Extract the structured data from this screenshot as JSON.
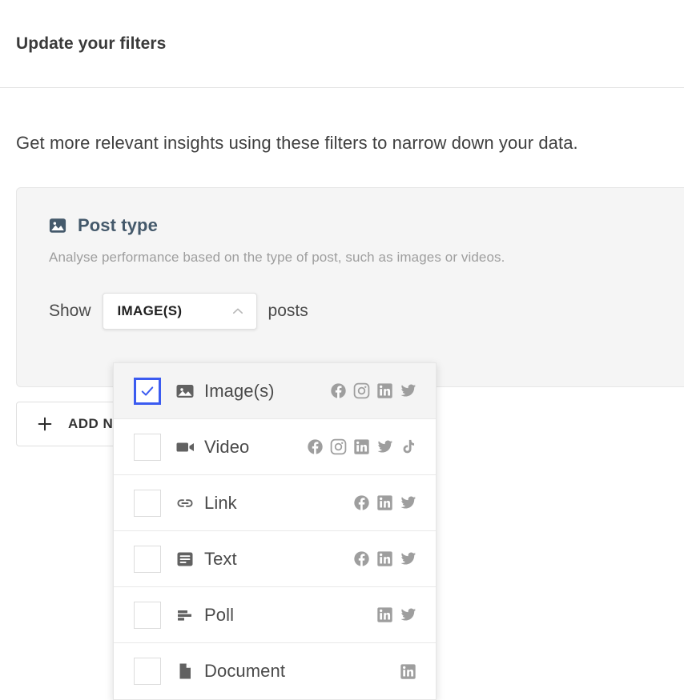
{
  "header": {
    "title": "Update your filters"
  },
  "body": {
    "intro": "Get more relevant insights using these filters to narrow down your data."
  },
  "filter_card": {
    "icon": "image-icon",
    "title": "Post type",
    "description": "Analyse performance based on the type of post, such as images or videos.",
    "prefix_word": "Show",
    "suffix_word": "posts",
    "select": {
      "value": "IMAGE(S)",
      "chevron": "chevron-up-icon",
      "expanded": true
    }
  },
  "add_filter_button": {
    "icon": "plus-icon",
    "label": "ADD NEW FILTER"
  },
  "dropdown": {
    "options": [
      {
        "label": "Image(s)",
        "icon": "image-icon",
        "checked": true,
        "networks": [
          "facebook",
          "instagram",
          "linkedin",
          "twitter"
        ]
      },
      {
        "label": "Video",
        "icon": "video-icon",
        "checked": false,
        "networks": [
          "facebook",
          "instagram",
          "linkedin",
          "twitter",
          "tiktok"
        ]
      },
      {
        "label": "Link",
        "icon": "link-icon",
        "checked": false,
        "networks": [
          "facebook",
          "linkedin",
          "twitter"
        ]
      },
      {
        "label": "Text",
        "icon": "text-icon",
        "checked": false,
        "networks": [
          "facebook",
          "linkedin",
          "twitter"
        ]
      },
      {
        "label": "Poll",
        "icon": "poll-icon",
        "checked": false,
        "networks": [
          "linkedin",
          "twitter"
        ]
      },
      {
        "label": "Document",
        "icon": "document-icon",
        "checked": false,
        "networks": [
          "linkedin"
        ]
      }
    ]
  },
  "colors": {
    "accent_blue": "#3b5bf0",
    "card_background": "#f5f5f5",
    "title_slate": "#44596b",
    "network_gray": "#9e9e9e"
  }
}
